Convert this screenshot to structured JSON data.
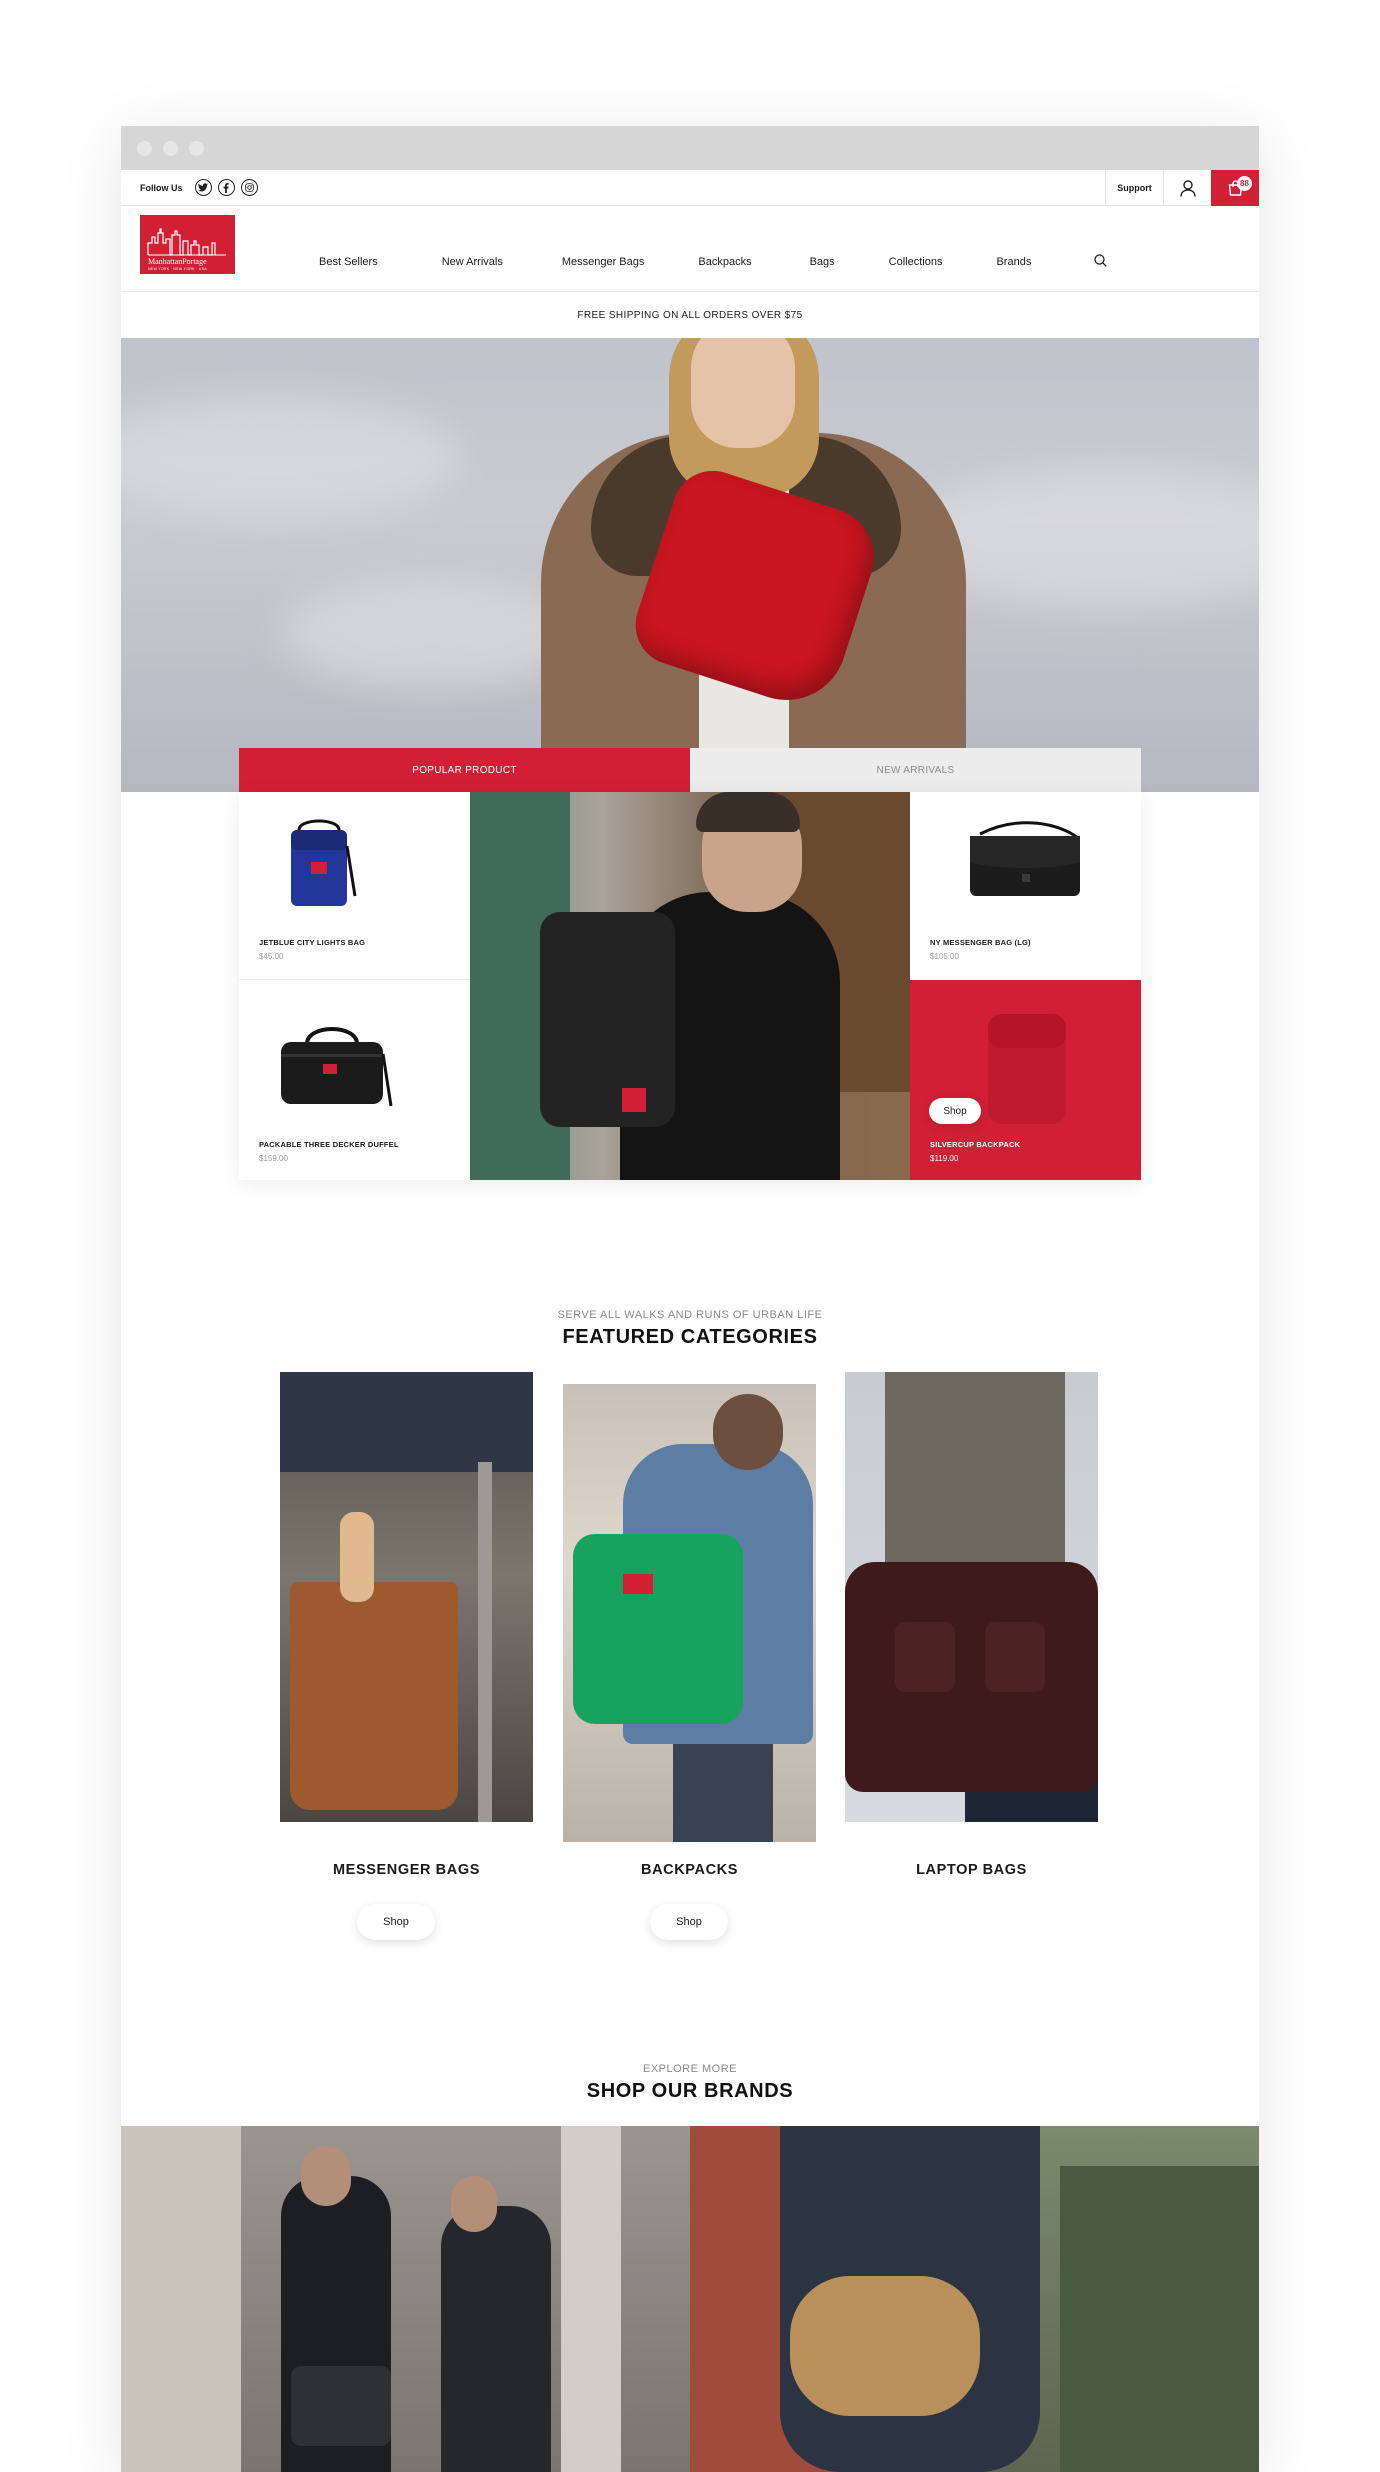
{
  "topbar": {
    "follow_label": "Follow Us",
    "social_icons": [
      "twitter-icon",
      "facebook-icon",
      "instagram-icon"
    ],
    "support_label": "Support",
    "cart_count": "88"
  },
  "nav": {
    "items": [
      "Best Sellers",
      "New Arrivals",
      "Messenger Bags",
      "Backpacks",
      "Bags",
      "Collections",
      "Brands"
    ]
  },
  "announcement": "FREE SHIPPING ON ALL ORDERS OVER $75",
  "product_tabs": [
    "POPULAR PRODUCT",
    "NEW ARRIVALS"
  ],
  "products": [
    {
      "name": "JETBLUE CITY LIGHTS BAG",
      "price": "$45.00"
    },
    {
      "name": "PACKABLE THREE DECKER DUFFEL",
      "price": "$159.00"
    },
    {
      "name": "NY MESSENGER BAG (LG)",
      "price": "$105.00"
    },
    {
      "name": "SILVERCUP BACKPACK",
      "price": "$119.00"
    }
  ],
  "shop_label": "Shop",
  "featured": {
    "kicker": "SERVE ALL WALKS AND RUNS OF URBAN LIFE",
    "title": "FEATURED CATEGORIES",
    "categories": [
      {
        "name": "MESSENGER BAGS",
        "button": "Shop"
      },
      {
        "name": "BACKPACKS",
        "button": "Shop"
      },
      {
        "name": "LAPTOP BAGS"
      }
    ]
  },
  "brands": {
    "kicker": "EXPLORE MORE",
    "title": "SHOP OUR BRANDS"
  },
  "colors": {
    "brand_red": "#d11f35",
    "chrome_gray": "#d6d6d6",
    "inactive_tab": "#ececec"
  }
}
